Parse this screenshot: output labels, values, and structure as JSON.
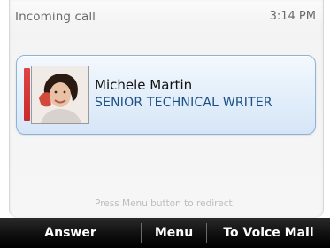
{
  "status_bar": {
    "title": "Incoming call",
    "time": "3:14 PM"
  },
  "caller": {
    "name": "Michele Martin",
    "title": "SENIOR TECHNICAL WRITER",
    "photo_icon": "contact-photo",
    "presence_color": "#d93636"
  },
  "hint": "Press Menu button to redirect.",
  "softkeys": {
    "left": "Answer",
    "middle": "Menu",
    "right": "To Voice Mail"
  },
  "colors": {
    "card_border": "#8fb3d6",
    "job_title": "#1c4f86",
    "softkey_bar": "#000000"
  }
}
